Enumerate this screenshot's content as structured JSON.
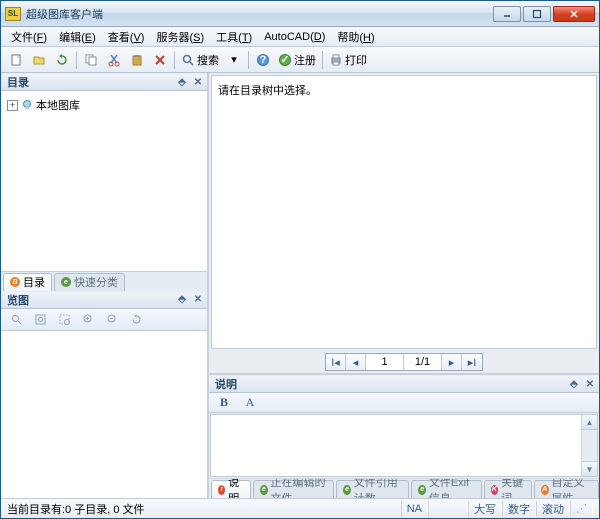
{
  "titlebar": {
    "app_icon": "SL",
    "title": "超级图库客户端"
  },
  "menu": {
    "file": "文件(",
    "file_u": "F",
    "file_e": ")",
    "edit": "编辑(",
    "edit_u": "E",
    "edit_e": ")",
    "view": "查看(",
    "view_u": "V",
    "view_e": ")",
    "server": "服务器(",
    "server_u": "S",
    "server_e": ")",
    "tool": "工具(",
    "tool_u": "T",
    "tool_e": ")",
    "autocad": "AutoCAD(",
    "autocad_u": "D",
    "autocad_e": ")",
    "help": "帮助(",
    "help_u": "H",
    "help_e": ")"
  },
  "toolbar": {
    "search": "搜索",
    "register": "注册",
    "print": "打印"
  },
  "sidebar": {
    "catalog_title": "目录",
    "tree_root": "本地图库",
    "tabs": {
      "catalog": "目录",
      "quick": "快速分类"
    },
    "preview_title": "览图"
  },
  "main": {
    "prompt": "请在目录树中选择。"
  },
  "pager": {
    "current": "1",
    "total": "1/1"
  },
  "description": {
    "title": "说明",
    "tabs": {
      "desc": "说明",
      "editing": "正在编辑的文件",
      "refcount": "文件引用计数",
      "exif": "文件Exif信息",
      "keyword": "关键词",
      "custom": "自定义属性"
    }
  },
  "status": {
    "left": "当前目录有:0 子目录, 0 文件",
    "na": "NA",
    "caps": "大写",
    "num": "数字",
    "scroll": "滚动"
  }
}
